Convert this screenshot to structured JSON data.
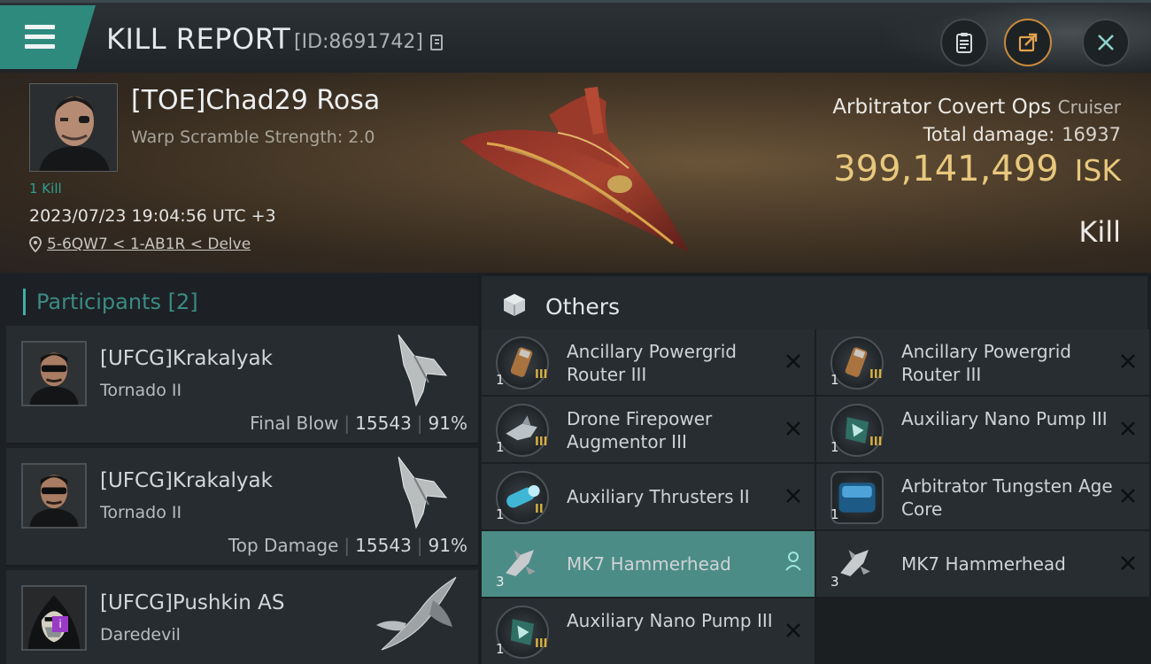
{
  "header": {
    "title": "KILL REPORT",
    "id_text": "[ID:8691742]"
  },
  "victim": {
    "name": "[TOE]Chad29 Rosa",
    "subtitle": "Warp Scramble Strength: 2.0",
    "kills_label": "1 Kill",
    "datetime": "2023/07/23 19:04:56 UTC +3",
    "location": "5-6QW7 < 1-AB1R < Delve",
    "ship_name": "Arbitrator Covert Ops",
    "ship_category": "Cruiser",
    "total_damage_label": "Total damage:",
    "total_damage": "16937",
    "isk_value": "399,141,499",
    "isk_unit": "ISK",
    "report_type": "Kill"
  },
  "participants": {
    "title": "Participants",
    "count": "[2]",
    "rows": [
      {
        "name": "[UFCG]Krakalyak",
        "ship": "Tornado II",
        "label": "Final Blow",
        "damage": "15543",
        "percent": "91%"
      },
      {
        "name": "[UFCG]Krakalyak",
        "ship": "Tornado II",
        "label": "Top Damage",
        "damage": "15543",
        "percent": "91%"
      },
      {
        "name": "[UFCG]Pushkin AS",
        "ship": "Daredevil",
        "label": "",
        "damage": "",
        "percent": ""
      }
    ]
  },
  "others": {
    "title": "Others",
    "items": [
      {
        "name": "Ancillary Powergrid Router III",
        "qty": "1",
        "meta": "III",
        "icon": "powergrid-router-icon"
      },
      {
        "name": "Ancillary Powergrid Router III",
        "qty": "1",
        "meta": "III",
        "icon": "powergrid-router-icon"
      },
      {
        "name": "Drone Firepower Augmentor III",
        "qty": "1",
        "meta": "III",
        "icon": "drone-augmentor-icon"
      },
      {
        "name": "Auxiliary Nano Pump III",
        "qty": "1",
        "meta": "III",
        "icon": "nano-pump-icon"
      },
      {
        "name": "Auxiliary Thrusters II",
        "qty": "1",
        "meta": "II",
        "icon": "thrusters-icon"
      },
      {
        "name": "Arbitrator Tungsten Age Core",
        "qty": "1",
        "meta": "",
        "icon": "tungsten-core-icon"
      },
      {
        "name": "MK7  Hammerhead",
        "qty": "3",
        "meta": "",
        "icon": "hammerhead-drone-icon"
      },
      {
        "name": "MK7  Hammerhead",
        "qty": "3",
        "meta": "",
        "icon": "hammerhead-drone-icon"
      },
      {
        "name": "Auxiliary Nano Pump III",
        "qty": "1",
        "meta": "III",
        "icon": "nano-pump-icon"
      }
    ]
  },
  "colors": {
    "accent_teal": "#2f8a7e",
    "isk_gold": "#e8c87d",
    "highlight_row": "#4b8c86"
  }
}
